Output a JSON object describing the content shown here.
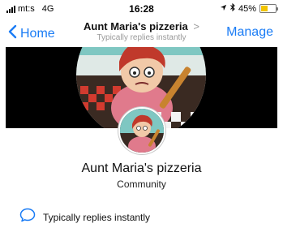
{
  "status_bar": {
    "carrier": "mt:s",
    "network": "4G",
    "time": "16:28",
    "battery": "45%",
    "battery_level_percent": 45
  },
  "nav": {
    "back_label": "Home",
    "title": "Aunt Maria's pizzeria",
    "title_chevron": ">",
    "subtitle": "Typically replies instantly",
    "manage_label": "Manage"
  },
  "profile": {
    "name": "Aunt Maria's pizzeria",
    "category": "Community"
  },
  "info": {
    "reply_text": "Typically replies instantly"
  },
  "colors": {
    "accent": "#1a7cf5",
    "battery_fill": "#f2c400"
  }
}
